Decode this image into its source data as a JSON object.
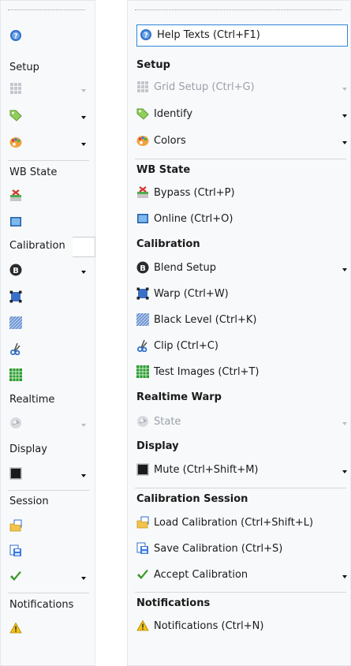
{
  "left_toolbar": {
    "setup_header": "Setup",
    "wb_state_header": "WB State",
    "calibration_header": "Calibration",
    "realtime_header": "Realtime",
    "display_header": "Display",
    "session_header": "Session",
    "notifications_header": "Notifications"
  },
  "right_toolbar": {
    "help_texts": "Help Texts (Ctrl+F1)",
    "setup_header": "Setup",
    "grid_setup": "Grid Setup (Ctrl+G)",
    "identify": "Identify",
    "colors": "Colors",
    "wb_state_header": "WB State",
    "bypass": "Bypass (Ctrl+P)",
    "online": "Online (Ctrl+O)",
    "calibration_header": "Calibration",
    "blend_setup": "Blend Setup",
    "warp": "Warp (Ctrl+W)",
    "black_level": "Black Level (Ctrl+K)",
    "clip": "Clip (Ctrl+C)",
    "test_images": "Test Images (Ctrl+T)",
    "realtime_warp_header": "Realtime Warp",
    "state": "State",
    "display_header": "Display",
    "mute": "Mute (Ctrl+Shift+M)",
    "calibration_session_header": "Calibration Session",
    "load_calibration": "Load Calibration (Ctrl+Shift+L)",
    "save_calibration": "Save Calibration (Ctrl+S)",
    "accept_calibration": "Accept Calibration",
    "notifications_header": "Notifications",
    "notifications": "Notifications (Ctrl+N)"
  },
  "colors": {
    "highlight_border": "#2e86d6",
    "help_blue": "#2f6fc9",
    "bypass_red": "#d2362c",
    "warning_yellow": "#f2c21b",
    "check_green": "#3a9a2a",
    "test_green": "#2a9a30"
  }
}
